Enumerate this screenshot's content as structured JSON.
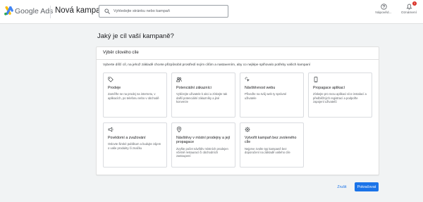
{
  "header": {
    "brand": "Google Ads",
    "page_title": "Nová kampaň",
    "search": {
      "placeholder": "Vyhledejte stránku nebo kampaň",
      "icon": "search-icon"
    },
    "help": {
      "label": "Nápověd...",
      "icon": "help-icon"
    },
    "notifications": {
      "label": "Oznámení",
      "count": "1",
      "icon": "bell-icon"
    }
  },
  "main": {
    "question": "Jaký je cíl vaší kampaně?",
    "panel": {
      "title": "Výběr cílového cíle",
      "description": "Vyberte dílčí cíl, na jehož základě chcete přizpůsobit prostředí svým cílům a nastavením, aby co nejlépe splňovalo potřeby vašich kampaní",
      "goals": [
        {
          "icon": "tag-icon",
          "title": "Prodeje",
          "description": "Zaměřte se na prodej na internetu, v aplikacích, po telefonu nebo v obchodě"
        },
        {
          "icon": "people-icon",
          "title": "Potenciální zákazníci",
          "description": "Vybízejte uživatele k akci a získejte tak další potenciální zákazníky a jiné konverze"
        },
        {
          "icon": "cursor-click-icon",
          "title": "Návštěvnost webu",
          "description": "Přiveďte na svůj web ty správné uživatele"
        },
        {
          "icon": "phone-icon",
          "title": "Propagace aplikací",
          "description": "Získejte pro svou aplikaci více instalací a předběžných registrací a podpořte zapojení uživatelů"
        },
        {
          "icon": "megaphone-icon",
          "title": "Povědomí a zvažování",
          "description": "Oslovte široké publikum a budujte zájem o vaše produkty či značku"
        },
        {
          "icon": "location-pin-icon",
          "title": "Návštěvy v místní prodejny a její propagace",
          "description": "Zvyšte počet návštěv místních prodejen včetně restaurací či obchodních zastoupení"
        },
        {
          "icon": "gear-icon",
          "title": "Vytvořit kampaň bez zvoleného cíle",
          "description": "Nejprve zvolte typ kampaně bez doporučení na základě vašeho cíle"
        }
      ]
    }
  },
  "footer": {
    "cancel_label": "Zrušit",
    "continue_label": "Pokračovat"
  },
  "colors": {
    "accent": "#1a73e8",
    "badge": "#d93025",
    "background": "#f1f3f4"
  }
}
